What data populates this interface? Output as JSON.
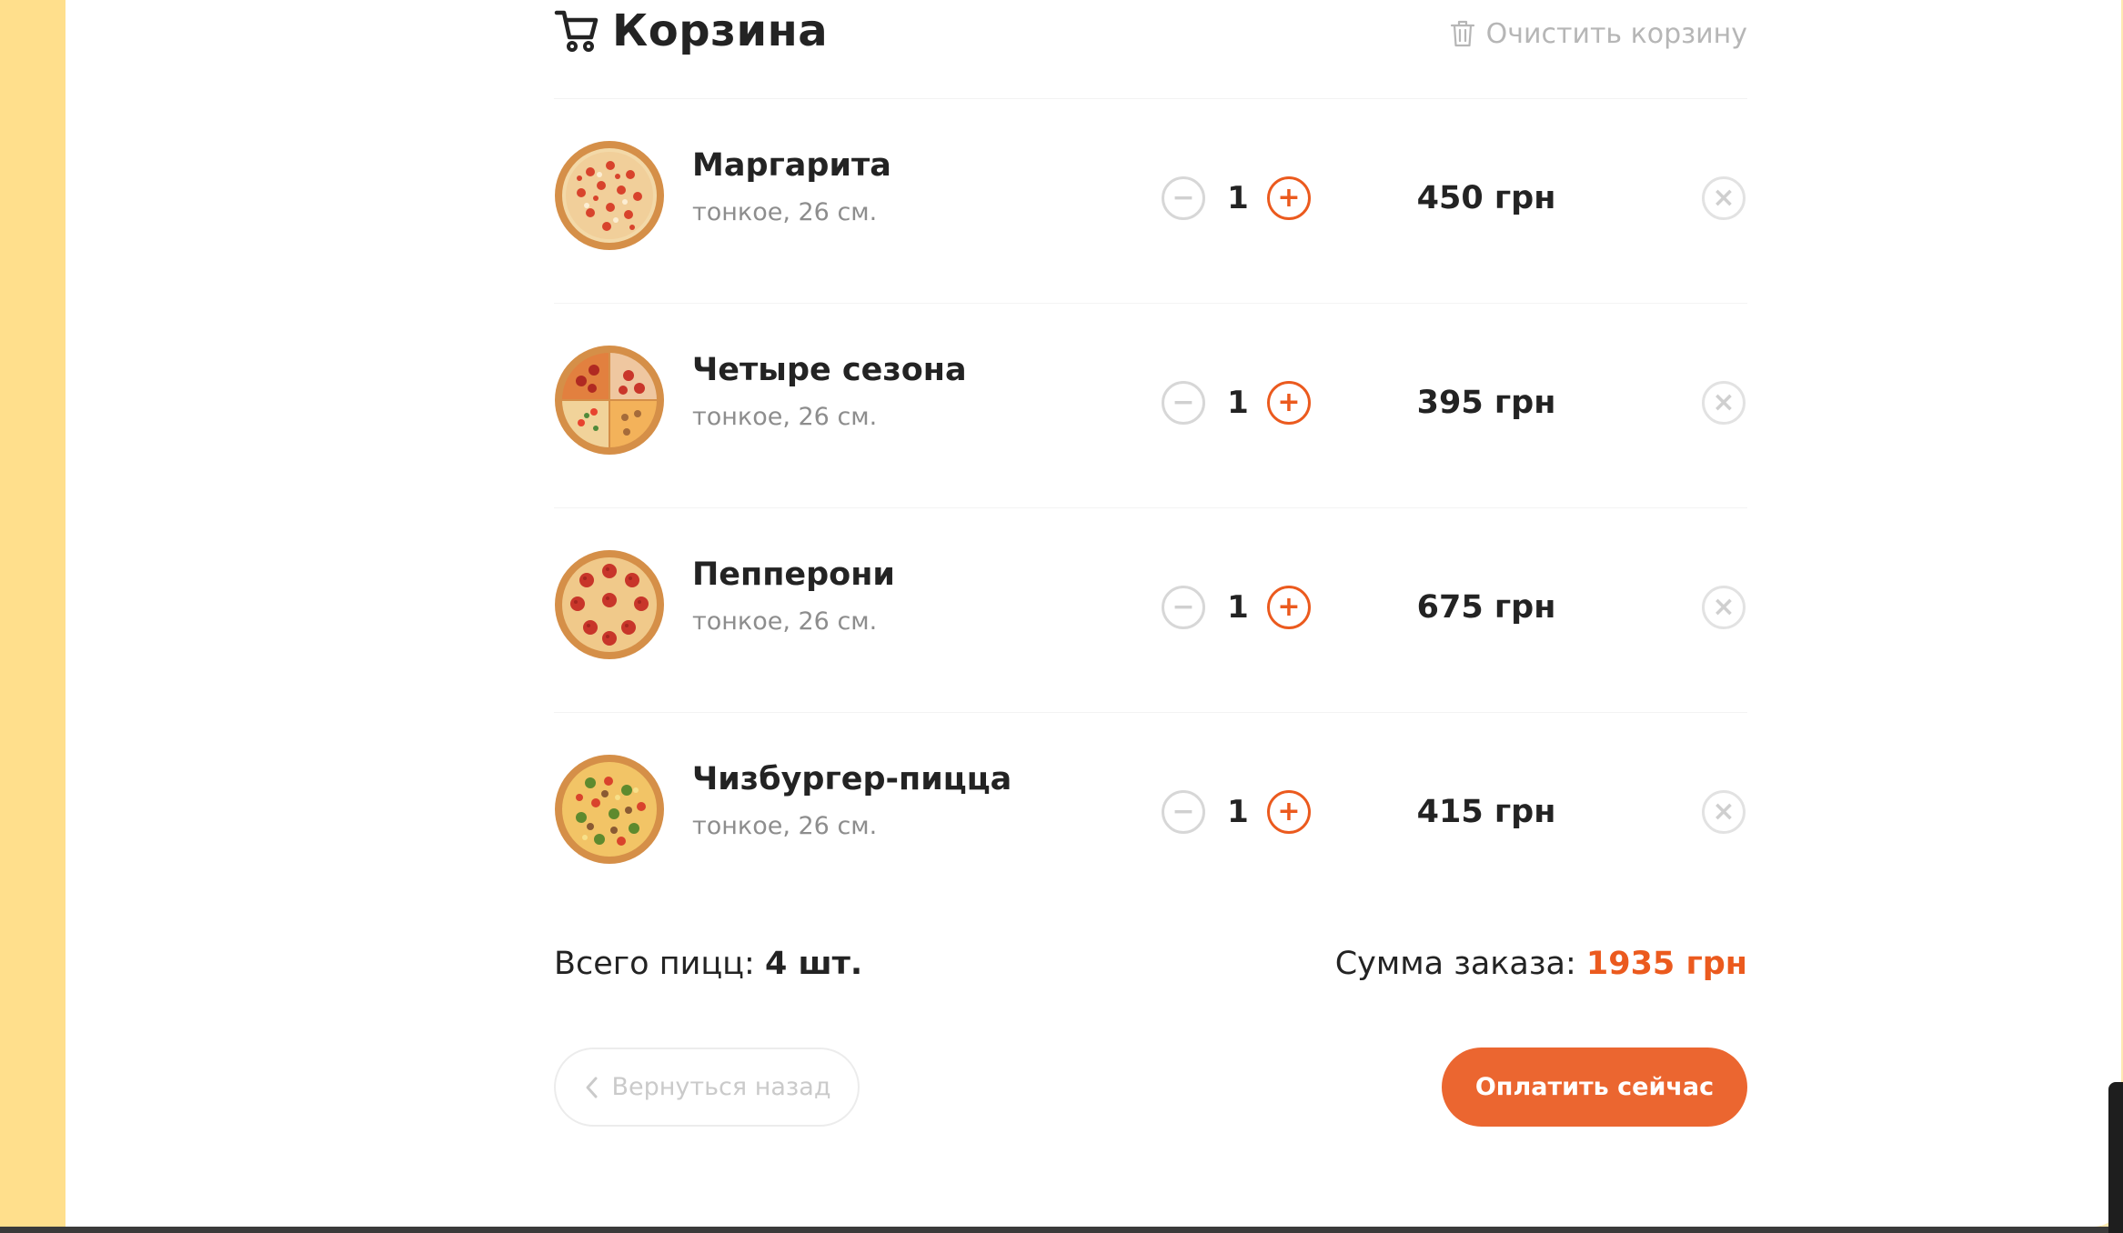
{
  "cart": {
    "title": "Корзина",
    "clear_label": "Очистить корзину",
    "items": [
      {
        "name": "Маргарита",
        "desc": "тонкое, 26 см.",
        "qty": "1",
        "price": "450 грн",
        "image": "margarita-pizza"
      },
      {
        "name": "Четыре сезона",
        "desc": "тонкое, 26 см.",
        "qty": "1",
        "price": "395 грн",
        "image": "four-seasons-pizza"
      },
      {
        "name": "Пепперони",
        "desc": "тонкое, 26 см.",
        "qty": "1",
        "price": "675 грн",
        "image": "pepperoni-pizza"
      },
      {
        "name": "Чизбургер-пицца",
        "desc": "тонкое, 26 см.",
        "qty": "1",
        "price": "415 грн",
        "image": "cheeseburger-pizza"
      }
    ],
    "total_count_label": "Всего пицц:",
    "total_count_value": "4 шт.",
    "total_sum_label": "Сумма заказа:",
    "total_sum_value": "1935 грн",
    "back_label": "Вернуться назад",
    "pay_label": "Оплатить сейчас"
  },
  "icons": {
    "cart": "cart-icon",
    "trash": "trash-icon",
    "minus": "minus-icon",
    "plus": "plus-icon",
    "remove": "close-icon",
    "back": "chevron-left-icon"
  },
  "colors": {
    "accent": "#eb5a1e",
    "pay_button": "#eb6630",
    "backdrop": "#ffdf8c",
    "muted_text": "#8d8d8d"
  }
}
